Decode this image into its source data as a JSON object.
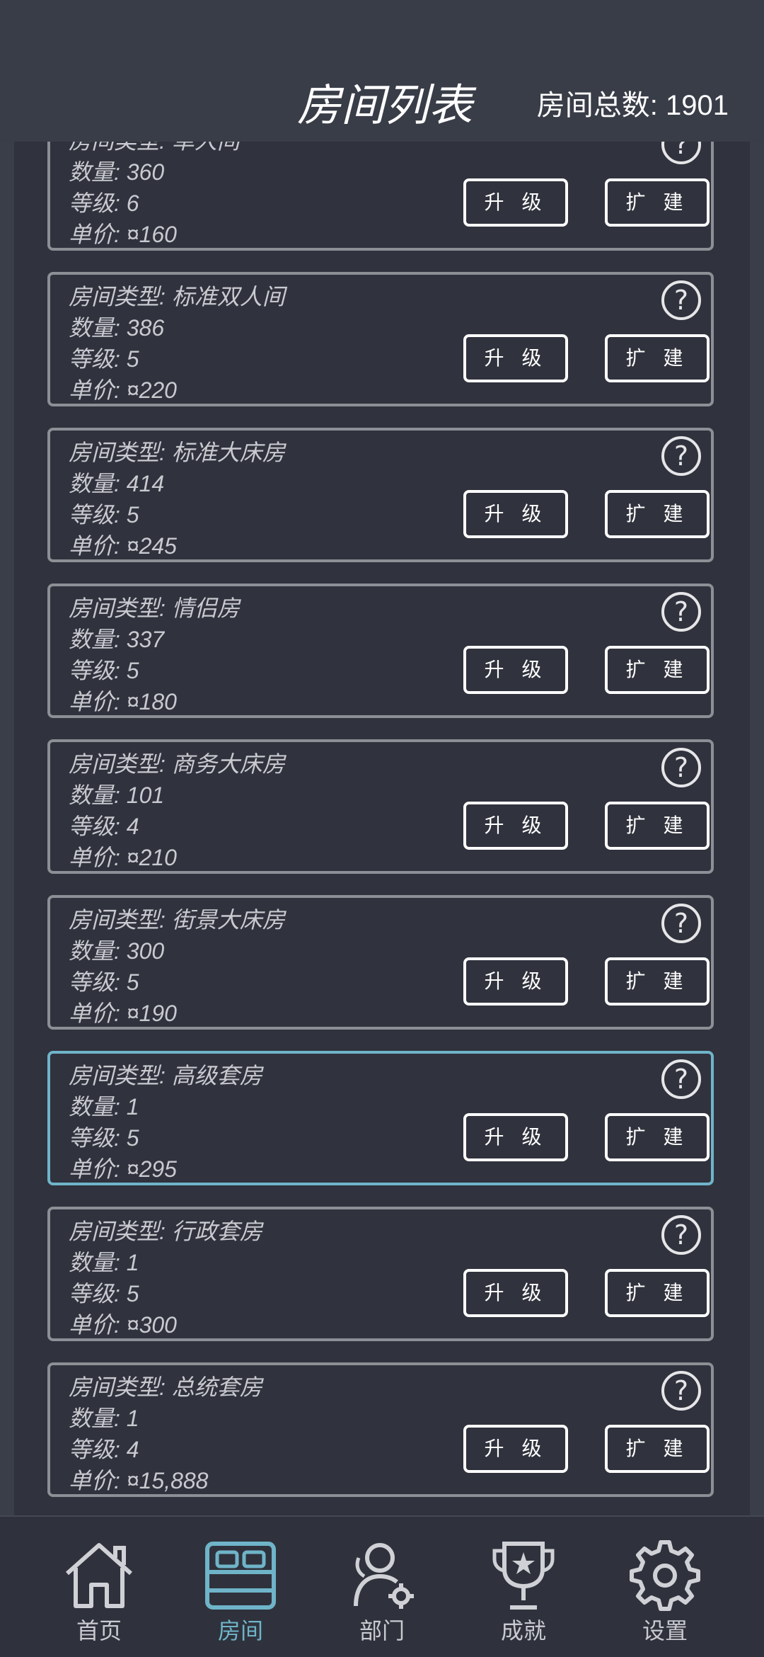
{
  "header": {
    "title": "房间列表",
    "total": "房间总数: 1901"
  },
  "buttons": {
    "upgrade": "升 级",
    "expand": "扩 建"
  },
  "rooms": [
    {
      "type": "房间类型: 单人间",
      "count": "数量: 360",
      "level": "等级: 6",
      "price": "单价: ¤160"
    },
    {
      "type": "房间类型: 标准双人间",
      "count": "数量: 386",
      "level": "等级: 5",
      "price": "单价: ¤220"
    },
    {
      "type": "房间类型: 标准大床房",
      "count": "数量: 414",
      "level": "等级: 5",
      "price": "单价: ¤245"
    },
    {
      "type": "房间类型: 情侣房",
      "count": "数量: 337",
      "level": "等级: 5",
      "price": "单价: ¤180"
    },
    {
      "type": "房间类型: 商务大床房",
      "count": "数量: 101",
      "level": "等级: 4",
      "price": "单价: ¤210"
    },
    {
      "type": "房间类型: 街景大床房",
      "count": "数量: 300",
      "level": "等级: 5",
      "price": "单价: ¤190"
    },
    {
      "type": "房间类型: 高级套房",
      "count": "数量: 1",
      "level": "等级: 5",
      "price": "单价: ¤295"
    },
    {
      "type": "房间类型: 行政套房",
      "count": "数量: 1",
      "level": "等级: 5",
      "price": "单价: ¤300"
    },
    {
      "type": "房间类型: 总统套房",
      "count": "数量: 1",
      "level": "等级: 4",
      "price": "单价: ¤15,888"
    }
  ],
  "nav": [
    {
      "label": "首页",
      "icon": "home-icon"
    },
    {
      "label": "房间",
      "icon": "bed-icon"
    },
    {
      "label": "部门",
      "icon": "staff-gear-icon"
    },
    {
      "label": "成就",
      "icon": "trophy-icon"
    },
    {
      "label": "设置",
      "icon": "gear-icon"
    }
  ],
  "colors": {
    "accent": "#6fb4c9",
    "background": "#30323d",
    "header": "#393d47"
  }
}
